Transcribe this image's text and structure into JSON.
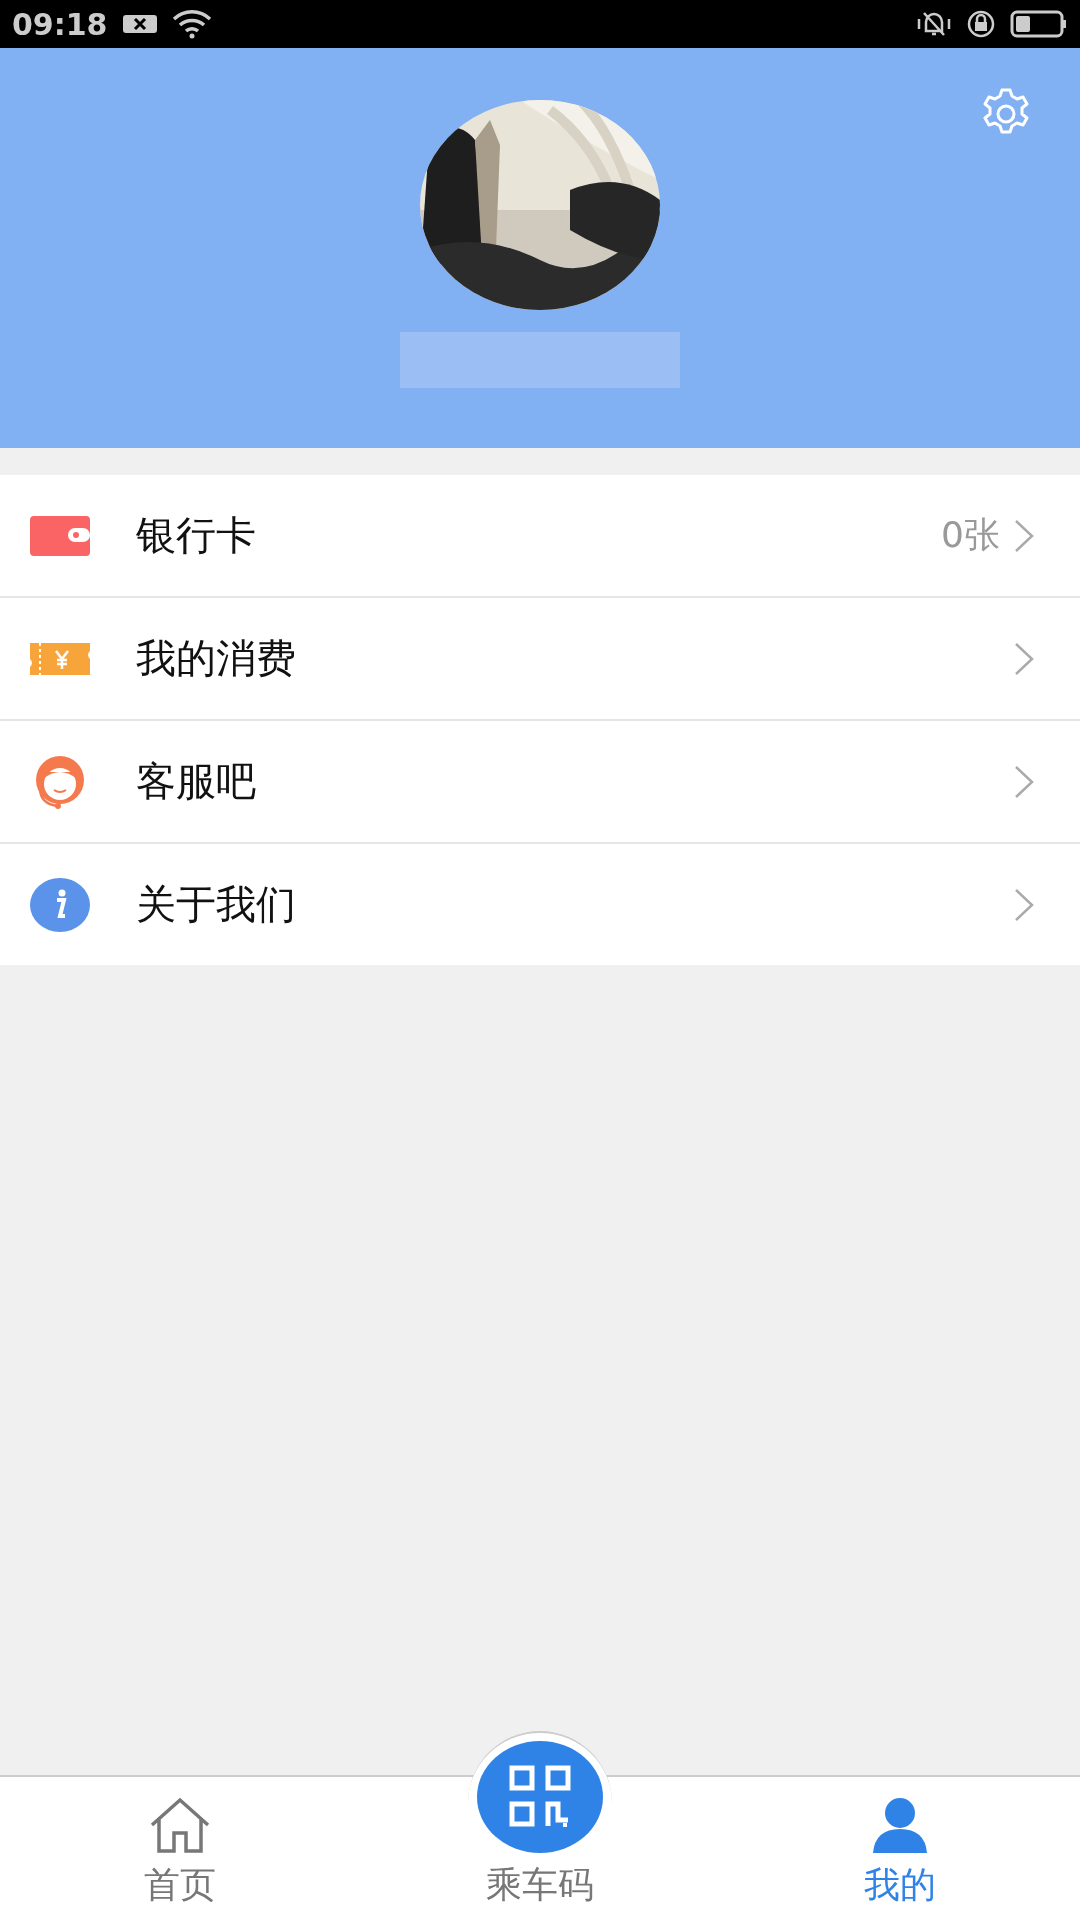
{
  "status_bar": {
    "time": "09:18"
  },
  "menu": [
    {
      "kind": "wallet",
      "label": "银行卡",
      "value": "0张"
    },
    {
      "kind": "ticket",
      "label": "我的消费"
    },
    {
      "kind": "support",
      "label": "客服吧"
    },
    {
      "kind": "info",
      "label": "关于我们"
    }
  ],
  "tab_bar": [
    {
      "kind": "home",
      "label": "首页",
      "selected": false
    },
    {
      "kind": "qr",
      "label": "乘车码",
      "selected": false
    },
    {
      "kind": "user",
      "label": "我的",
      "selected": true
    }
  ]
}
